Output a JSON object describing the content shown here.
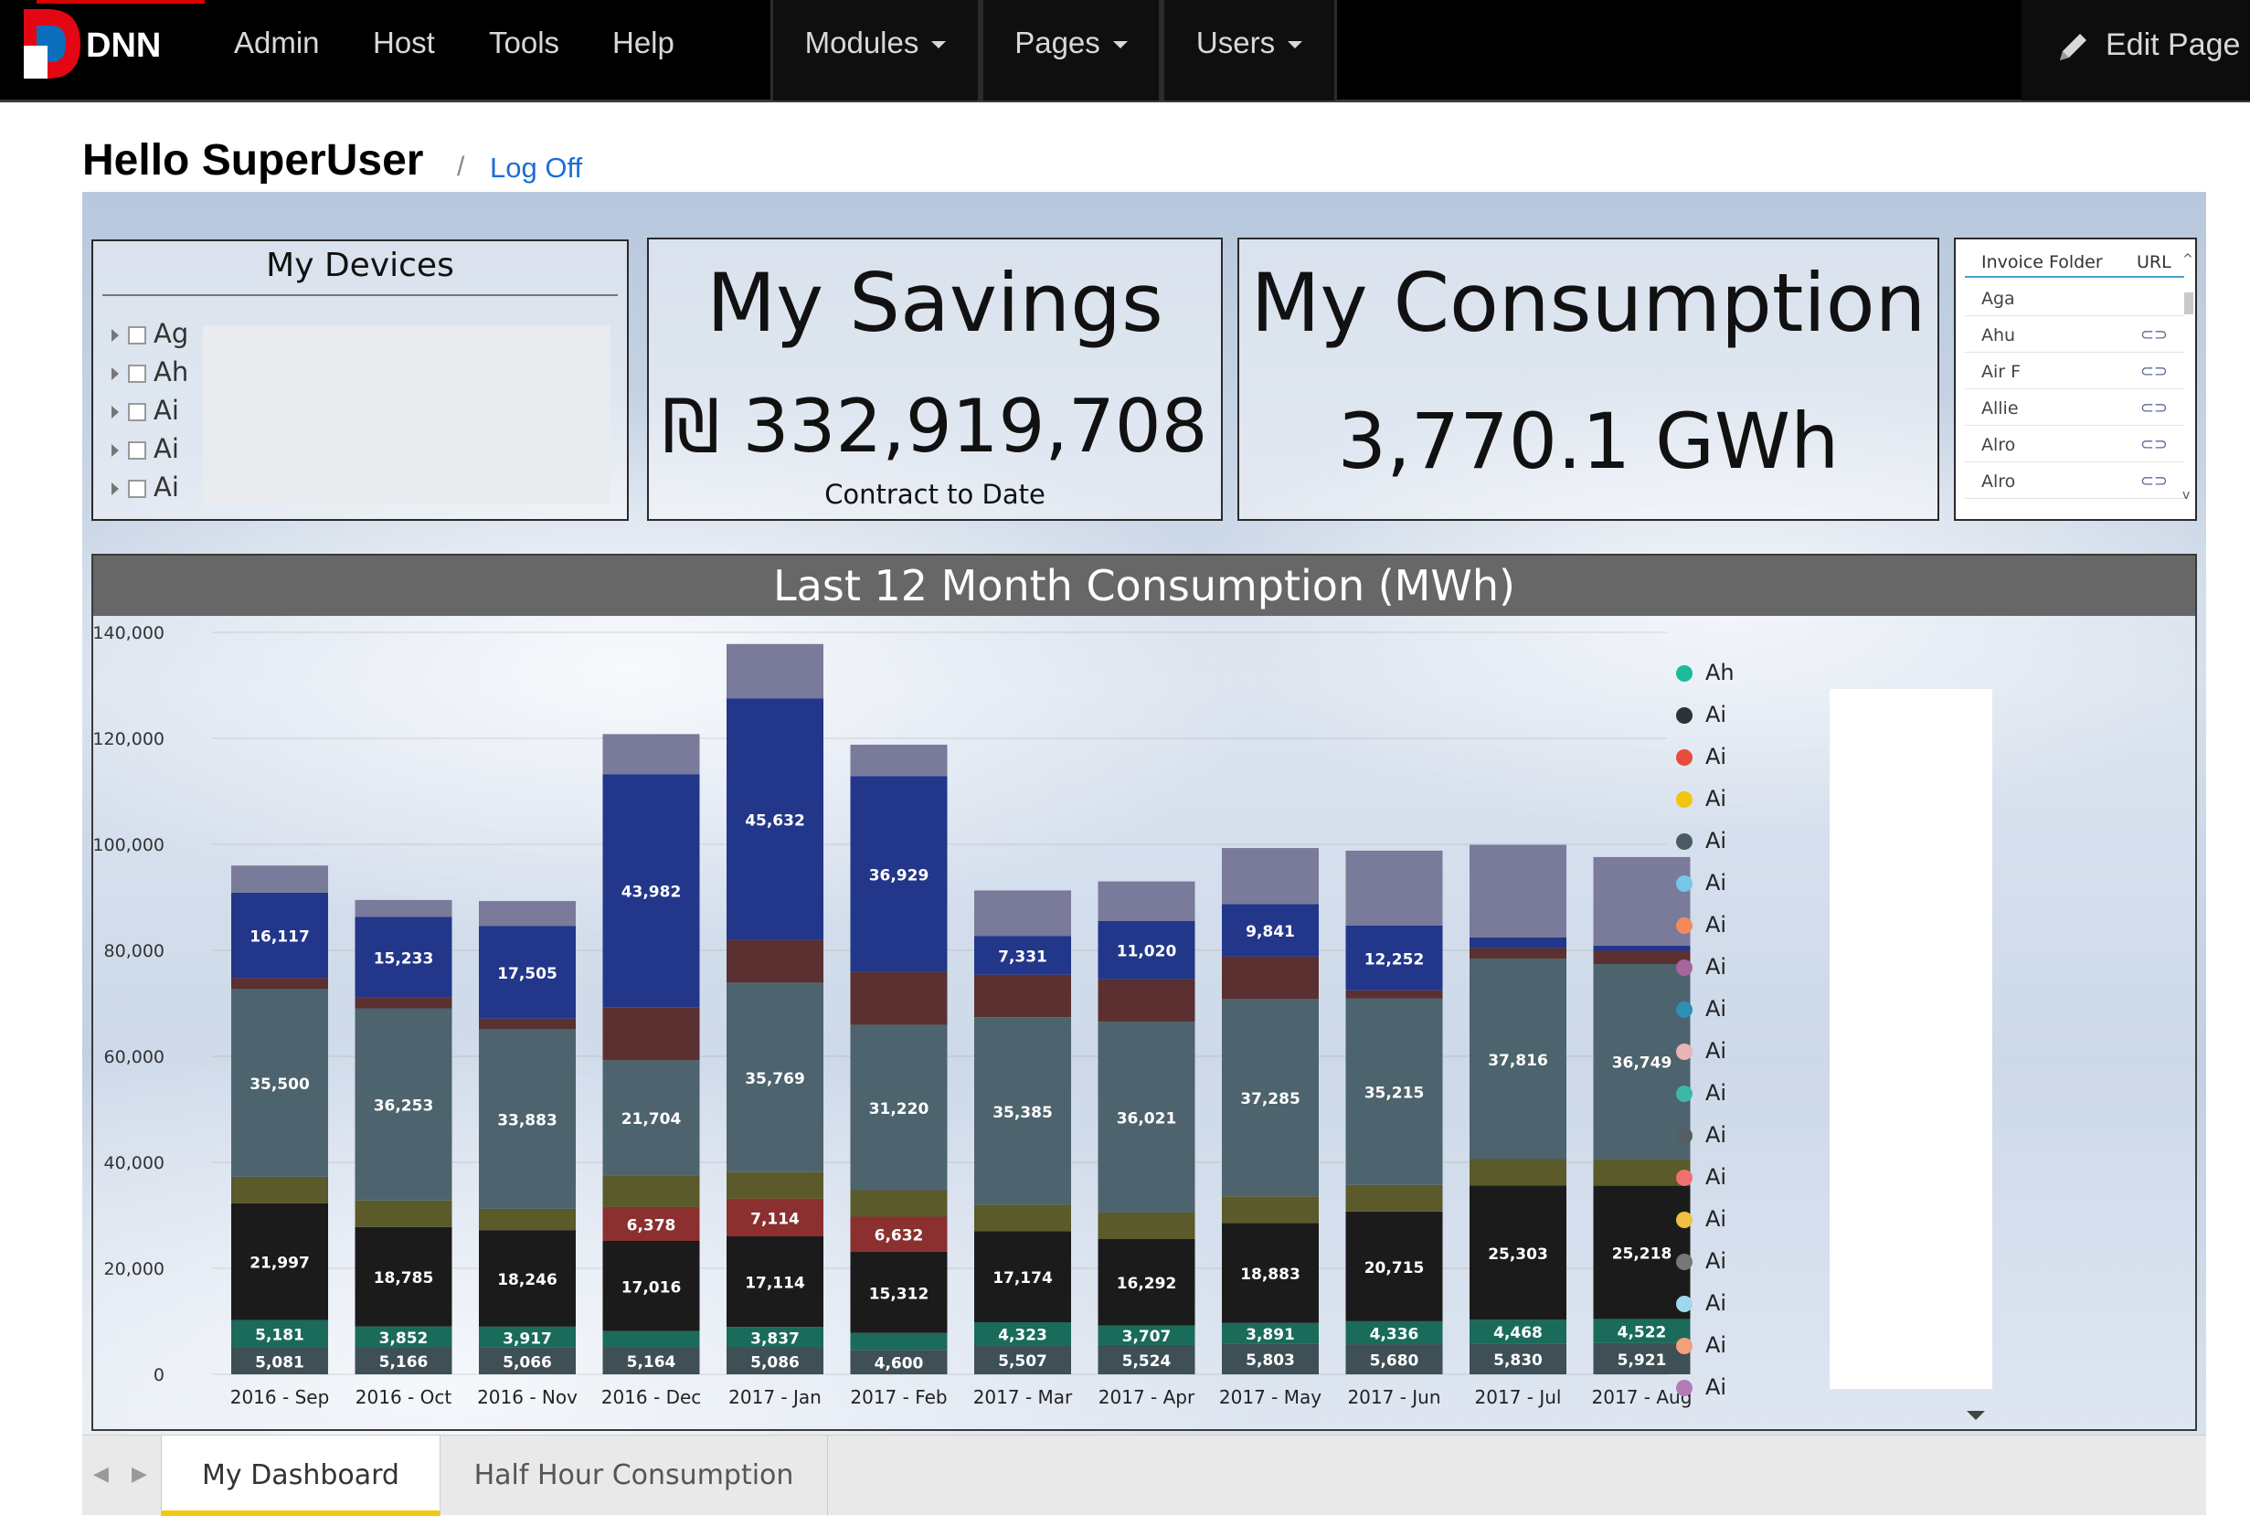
{
  "nav": {
    "admin_items": [
      "Admin",
      "Host",
      "Tools",
      "Help"
    ],
    "menus": [
      "Modules",
      "Pages",
      "Users"
    ],
    "edit_page": "Edit Page"
  },
  "greeting": {
    "hello": "Hello SuperUser",
    "separator": "/",
    "logoff": "Log Off"
  },
  "devices": {
    "title": "My Devices",
    "items": [
      "Ag",
      "Ah",
      "Ai",
      "Ai",
      "Ai"
    ]
  },
  "savings": {
    "title": "My Savings",
    "value": "₪ 332,919,708",
    "caption": "Contract to Date"
  },
  "consumption": {
    "title": "My Consumption",
    "value": "3,770.1 GWh"
  },
  "invoice": {
    "headers": {
      "folder": "Invoice Folder",
      "url": "URL"
    },
    "rows": [
      "Aga",
      "Ahu",
      "Air F",
      "Allie",
      "Alro",
      "Alro"
    ]
  },
  "tabs": [
    "My Dashboard",
    "Half Hour Consumption"
  ],
  "chart_data": {
    "type": "bar",
    "stacked": true,
    "title": "Last 12 Month Consumption (MWh)",
    "ylim": [
      0,
      140000
    ],
    "yticks": [
      "0",
      "20,000",
      "40,000",
      "60,000",
      "80,000",
      "100,000",
      "120,000",
      "140,000"
    ],
    "categories": [
      "2016 - Sep",
      "2016 - Oct",
      "2016 - Nov",
      "2016 - Dec",
      "2017 - Jan",
      "2017 - Feb",
      "2017 - Mar",
      "2017 - Apr",
      "2017 - May",
      "2017 - Jun",
      "2017 - Jul",
      "2017 - Aug"
    ],
    "totals": [
      96000,
      89500,
      89300,
      120800,
      137800,
      118800,
      91300,
      93000,
      99300,
      98800,
      99900,
      97600
    ],
    "series": [
      {
        "color": "#3e4f55",
        "values": [
          5081,
          5166,
          5066,
          5164,
          5086,
          4600,
          5507,
          5524,
          5803,
          5680,
          5830,
          5921
        ],
        "labels": [
          "5,081",
          "5,166",
          "5,066",
          "5,164",
          "5,086",
          "4,600",
          "5,507",
          "5,524",
          "5,803",
          "5,680",
          "5,830",
          "5,921"
        ]
      },
      {
        "color": "#1a6b5a",
        "values": [
          5181,
          3852,
          3917,
          3000,
          3837,
          3200,
          4323,
          3707,
          3891,
          4336,
          4468,
          4522
        ],
        "labels": [
          "5,181",
          "3,852",
          "3,917",
          "",
          "3,837",
          "",
          "4,323",
          "3,707",
          "3,891",
          "4,336",
          "4,468",
          "4,522"
        ]
      },
      {
        "color": "#1b1b1b",
        "values": [
          21997,
          18785,
          18246,
          17016,
          17114,
          15312,
          17174,
          16292,
          18883,
          20715,
          25303,
          25218
        ],
        "labels": [
          "21,997",
          "18,785",
          "18,246",
          "17,016",
          "17,114",
          "15,312",
          "17,174",
          "16,292",
          "18,883",
          "20,715",
          "25,303",
          "25,218"
        ]
      },
      {
        "color": "#8b2f2f",
        "values": [
          0,
          0,
          0,
          6378,
          7114,
          6632,
          0,
          0,
          0,
          0,
          0,
          0
        ],
        "labels": [
          "",
          "",
          "",
          "6,378",
          "7,114",
          "6,632",
          "",
          "",
          "",
          "",
          "",
          ""
        ]
      },
      {
        "color": "#5a5a2a",
        "values": [
          5000,
          5000,
          4000,
          6000,
          5000,
          5000,
          5000,
          5000,
          5000,
          5000,
          5000,
          5000
        ],
        "labels": [
          "",
          "",
          "",
          "",
          "",
          "",
          "",
          "",
          "",
          "",
          "",
          ""
        ]
      },
      {
        "color": "#4d636d",
        "values": [
          35500,
          36253,
          33883,
          21704,
          35769,
          31220,
          35385,
          36021,
          37285,
          35215,
          37816,
          36749
        ],
        "labels": [
          "35,500",
          "36,253",
          "33,883",
          "21,704",
          "35,769",
          "31,220",
          "35,385",
          "36,021",
          "37,285",
          "35,215",
          "37,816",
          "36,749"
        ]
      },
      {
        "color": "#5b3030",
        "values": [
          2000,
          2000,
          2000,
          10000,
          8000,
          10000,
          8000,
          8000,
          8000,
          1500,
          2000,
          2500
        ],
        "labels": [
          "",
          "",
          "",
          "",
          "",
          "",
          "",
          "",
          "",
          "",
          "",
          ""
        ]
      },
      {
        "color": "#22368a",
        "values": [
          16117,
          15233,
          17505,
          43982,
          45632,
          36929,
          7331,
          11020,
          9841,
          12252,
          2000,
          1000
        ],
        "labels": [
          "16,117",
          "15,233",
          "17,505",
          "43,982",
          "45,632",
          "36,929",
          "7,331",
          "11,020",
          "9,841",
          "12,252",
          "",
          ""
        ]
      }
    ]
  },
  "legend": [
    {
      "label": "Ah",
      "color": "#1abc9c"
    },
    {
      "label": "Ai",
      "color": "#2d3436"
    },
    {
      "label": "Ai",
      "color": "#e74c3c"
    },
    {
      "label": "Ai",
      "color": "#f1c40f"
    },
    {
      "label": "Ai",
      "color": "#4b5b61"
    },
    {
      "label": "Ai",
      "color": "#74c7e8"
    },
    {
      "label": "Ai",
      "color": "#f48a5c"
    },
    {
      "label": "Ai",
      "color": "#a5669e"
    },
    {
      "label": "Ai",
      "color": "#2d8fb4"
    },
    {
      "label": "Ai",
      "color": "#e8b4b8"
    },
    {
      "label": "Ai",
      "color": "#3cb9a6"
    },
    {
      "label": "Ai",
      "color": "#555f61"
    },
    {
      "label": "Ai",
      "color": "#f07070"
    },
    {
      "label": "Ai",
      "color": "#f0c040"
    },
    {
      "label": "Ai",
      "color": "#777777"
    },
    {
      "label": "Ai",
      "color": "#9fd8ec"
    },
    {
      "label": "Ai",
      "color": "#f4a07a"
    },
    {
      "label": "Ai",
      "color": "#b47cb4"
    }
  ]
}
